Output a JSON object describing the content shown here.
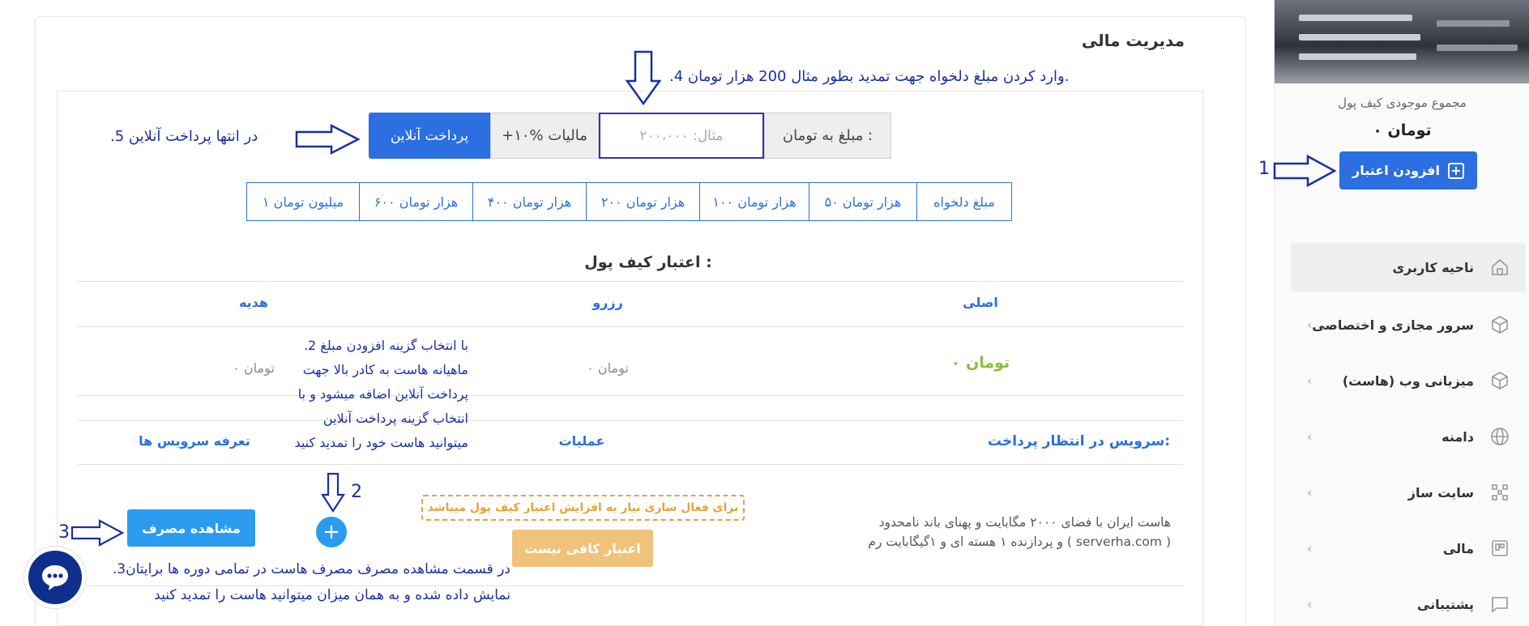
{
  "page_title": "مدیریت مالی",
  "sidebar": {
    "wallet_title": "مجموع موجودی کیف پول",
    "wallet_balance": "۰ تومان",
    "add_credit_label": "افزودن اعتبار",
    "items": [
      {
        "label": "ناحیه کاربری",
        "icon": "home-icon"
      },
      {
        "label": "سرور مجازی و اختصاصی",
        "icon": "cube-icon"
      },
      {
        "label": "میزبانی وب (هاست)",
        "icon": "box-icon"
      },
      {
        "label": "دامنه",
        "icon": "globe-icon"
      },
      {
        "label": "سایت ساز",
        "icon": "grid-icon"
      },
      {
        "label": "مالی",
        "icon": "finance-icon"
      },
      {
        "label": "پشتیبانی",
        "icon": "chat-icon"
      }
    ]
  },
  "amount_form": {
    "label": "مبلغ به تومان :",
    "placeholder": "مثال: ۲۰۰،۰۰۰",
    "tax": "+۱۰% مالیات",
    "pay_button": "پرداخت آنلاین"
  },
  "presets": [
    "مبلغ دلخواه",
    "۵۰ هزار تومان",
    "۱۰۰ هزار تومان",
    "۲۰۰ هزار تومان",
    "۴۰۰ هزار تومان",
    "۶۰۰ هزار تومان",
    "۱ میلیون تومان"
  ],
  "wallet_credit": {
    "title": "اعتبار کیف پول :",
    "columns": [
      "اصلی",
      "رزرو",
      "هدیه"
    ],
    "values": [
      "۰ تومان",
      "۰ تومان",
      "۰ تومان"
    ]
  },
  "services": {
    "pending_title": "سرویس در انتظار پرداخت:",
    "operations_header": "عملیات",
    "tariffs_link": "تعرفه سرویس ها",
    "description_line1": "هاست ایران با فضای ۲۰۰۰ مگابایت و پهنای باند نامحدود",
    "description_line2": "و پردازنده ۱ هسته ای و ۱گیگابایت رم ( serverha.com )",
    "activation_note": "برای فعال سازی نیاز به افزایش اعتبار کیف پول میباشد",
    "no_credit_button": "اعتبار کافی نیست",
    "usage_button": "مشاهده مصرف"
  },
  "annotations": {
    "step4": ".4 وارد کردن مبلغ دلخواه جهت تمدید بطور مثال 200 هزار تومان.",
    "step5": ".5 در انتها پرداخت آنلاین",
    "step2_lines": [
      ".2 با انتخاب گزینه افزودن مبلغ",
      "ماهیانه هاست به کادر بالا جهت",
      "پرداخت آنلاین اضافه میشود و با",
      "انتخاب گزینه پرداخت آنلاین",
      "میتوانید هاست خود را تمدید کنید"
    ],
    "step3_lines": [
      ".3در قسمت مشاهده مصرف مصرف هاست در تمامی دوره ها برایتان",
      "نمایش داده شده و به همان میزان میتوانید هاست را تمدید کنید"
    ],
    "num1": "1",
    "num2": "2",
    "num3": "3"
  },
  "colors": {
    "primary": "#2b6fe0",
    "success": "#8bbf3c",
    "warning": "#e8a13a",
    "annotation": "#1a2ea8"
  }
}
